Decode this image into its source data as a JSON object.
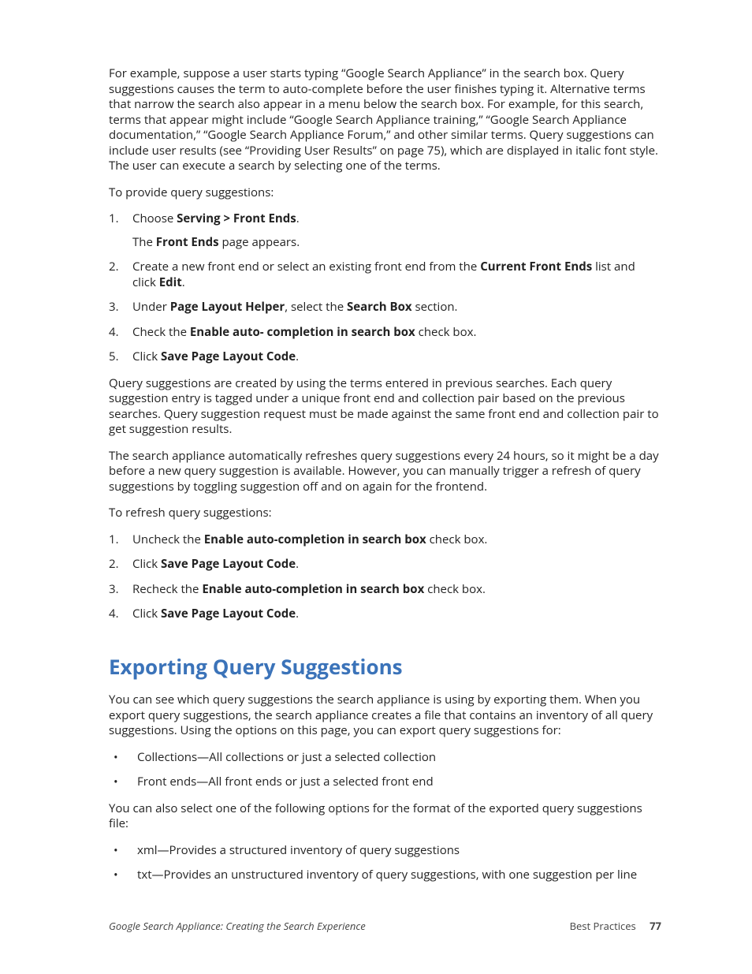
{
  "intro_para": "For example, suppose a user starts typing “Google Search Appliance” in the search box. Query suggestions causes the term to auto-complete before the user finishes typing it. Alternative terms that narrow the search also appear in a menu below the search box. For example, for this search, terms that appear might include “Google Search Appliance training,” “Google Search Appliance documentation,” “Google Search Appliance Forum,” and other similar terms. Query suggestions can include user results (see “Providing User Results” on page 75), which are displayed in italic font style. The user can execute a search by selecting one of the terms.",
  "lead1": "To provide query suggestions:",
  "steps1": {
    "s1_a": "Choose ",
    "s1_b": "Serving > Front Ends",
    "s1_c": ".",
    "s1_sub_a": "The ",
    "s1_sub_b": "Front Ends",
    "s1_sub_c": " page appears.",
    "s2_a": "Create a new front end or select an existing front end from the ",
    "s2_b": "Current Front Ends",
    "s2_c": " list and click ",
    "s2_d": "Edit",
    "s2_e": ".",
    "s3_a": "Under ",
    "s3_b": "Page Layout Helper",
    "s3_c": ", select the ",
    "s3_d": "Search Box",
    "s3_e": " section.",
    "s4_a": "Check the ",
    "s4_b": "Enable auto- completion in search box",
    "s4_c": " check box.",
    "s5_a": "Click ",
    "s5_b": "Save Page Layout Code",
    "s5_c": "."
  },
  "para2": "Query suggestions are created by using the terms entered in previous searches. Each query suggestion entry is tagged under a unique front end and collection pair based on the previous searches. Query suggestion request must be made against the same front end and collection pair to get suggestion results.",
  "para3": "The search appliance automatically refreshes query suggestions every 24 hours, so it might be a day before a new query suggestion is available. However, you can manually trigger a refresh of query suggestions by toggling suggestion off and on again for the frontend.",
  "lead2": "To refresh query suggestions:",
  "steps2": {
    "s1_a": "Uncheck the ",
    "s1_b": "Enable auto-completion in search box",
    "s1_c": " check box.",
    "s2_a": "Click ",
    "s2_b": "Save Page Layout Code",
    "s2_c": ".",
    "s3_a": "Recheck the ",
    "s3_b": "Enable auto-completion in search box",
    "s3_c": " check box.",
    "s4_a": "Click ",
    "s4_b": "Save Page Layout Code",
    "s4_c": "."
  },
  "h2": "Exporting Query Suggestions",
  "exp_p1": "You can see which query suggestions the search appliance is using by exporting them. When you export query suggestions, the search appliance creates a file that contains an inventory of all query suggestions. Using the options on this page, you can export query suggestions for:",
  "exp_b1": "Collections—All collections or just a selected collection",
  "exp_b2": "Front ends—All front ends or just a selected front end",
  "exp_p2": "You can also select one of the following options for the format of the exported query suggestions file:",
  "exp_b3": "xml—Provides a structured inventory of query suggestions",
  "exp_b4": "txt—Provides an unstructured inventory of query suggestions, with one suggestion per line",
  "footer": {
    "left": "Google Search Appliance: Creating the Search Experience",
    "right": "Best Practices",
    "page": "77"
  },
  "nums": {
    "n1": "1.",
    "n2": "2.",
    "n3": "3.",
    "n4": "4.",
    "n5": "5."
  },
  "bullet": "•"
}
